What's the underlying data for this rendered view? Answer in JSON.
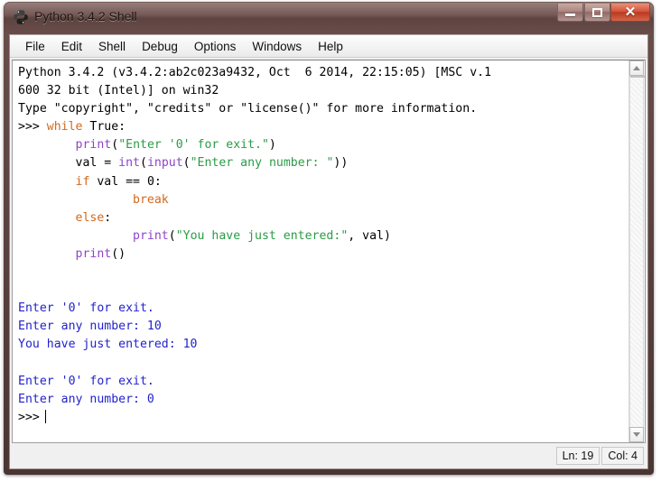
{
  "window": {
    "title": "Python 3.4.2 Shell",
    "icon": "python-logo-icon",
    "buttons": {
      "minimize": "—",
      "maximize": "□",
      "close": "✕"
    }
  },
  "menubar": {
    "items": [
      {
        "label": "File"
      },
      {
        "label": "Edit"
      },
      {
        "label": "Shell"
      },
      {
        "label": "Debug"
      },
      {
        "label": "Options"
      },
      {
        "label": "Windows"
      },
      {
        "label": "Help"
      }
    ]
  },
  "console": {
    "banner": [
      "Python 3.4.2 (v3.4.2:ab2c023a9432, Oct  6 2014, 22:15:05) [MSC v.1",
      "600 32 bit (Intel)] on win32",
      "Type \"copyright\", \"credits\" or \"license()\" for more information."
    ],
    "prompt": ">>>",
    "code": {
      "line1_kw": "while",
      "line1_rest": " True:",
      "line2_indent": "        ",
      "line2_fn": "print",
      "line2_open": "(",
      "line2_str": "\"Enter '0' for exit.\"",
      "line2_close": ")",
      "line3_indent": "        ",
      "line3_assign": "val = ",
      "line3_int": "int",
      "line3_p1": "(",
      "line3_input": "input",
      "line3_p2": "(",
      "line3_str": "\"Enter any number: \"",
      "line3_close": "))",
      "line4_indent": "        ",
      "line4_kw": "if",
      "line4_rest": " val == 0:",
      "line5_indent": "                ",
      "line5_kw": "break",
      "line6_indent": "        ",
      "line6_kw": "else",
      "line6_rest": ":",
      "line7_indent": "                ",
      "line7_fn": "print",
      "line7_open": "(",
      "line7_str": "\"You have just entered:\"",
      "line7_rest": ", val)",
      "line8_indent": "        ",
      "line8_fn": "print",
      "line8_rest": "()"
    },
    "output": [
      "Enter '0' for exit.",
      "Enter any number: 10",
      "You have just entered: 10",
      "",
      "Enter '0' for exit.",
      "Enter any number: 0"
    ],
    "final_prompt": ">>>"
  },
  "scrollbar": {
    "up_arrow": "scroll-up-arrow-icon",
    "down_arrow": "scroll-down-arrow-icon"
  },
  "statusbar": {
    "line": "Ln: 19",
    "col": "Col: 4"
  }
}
